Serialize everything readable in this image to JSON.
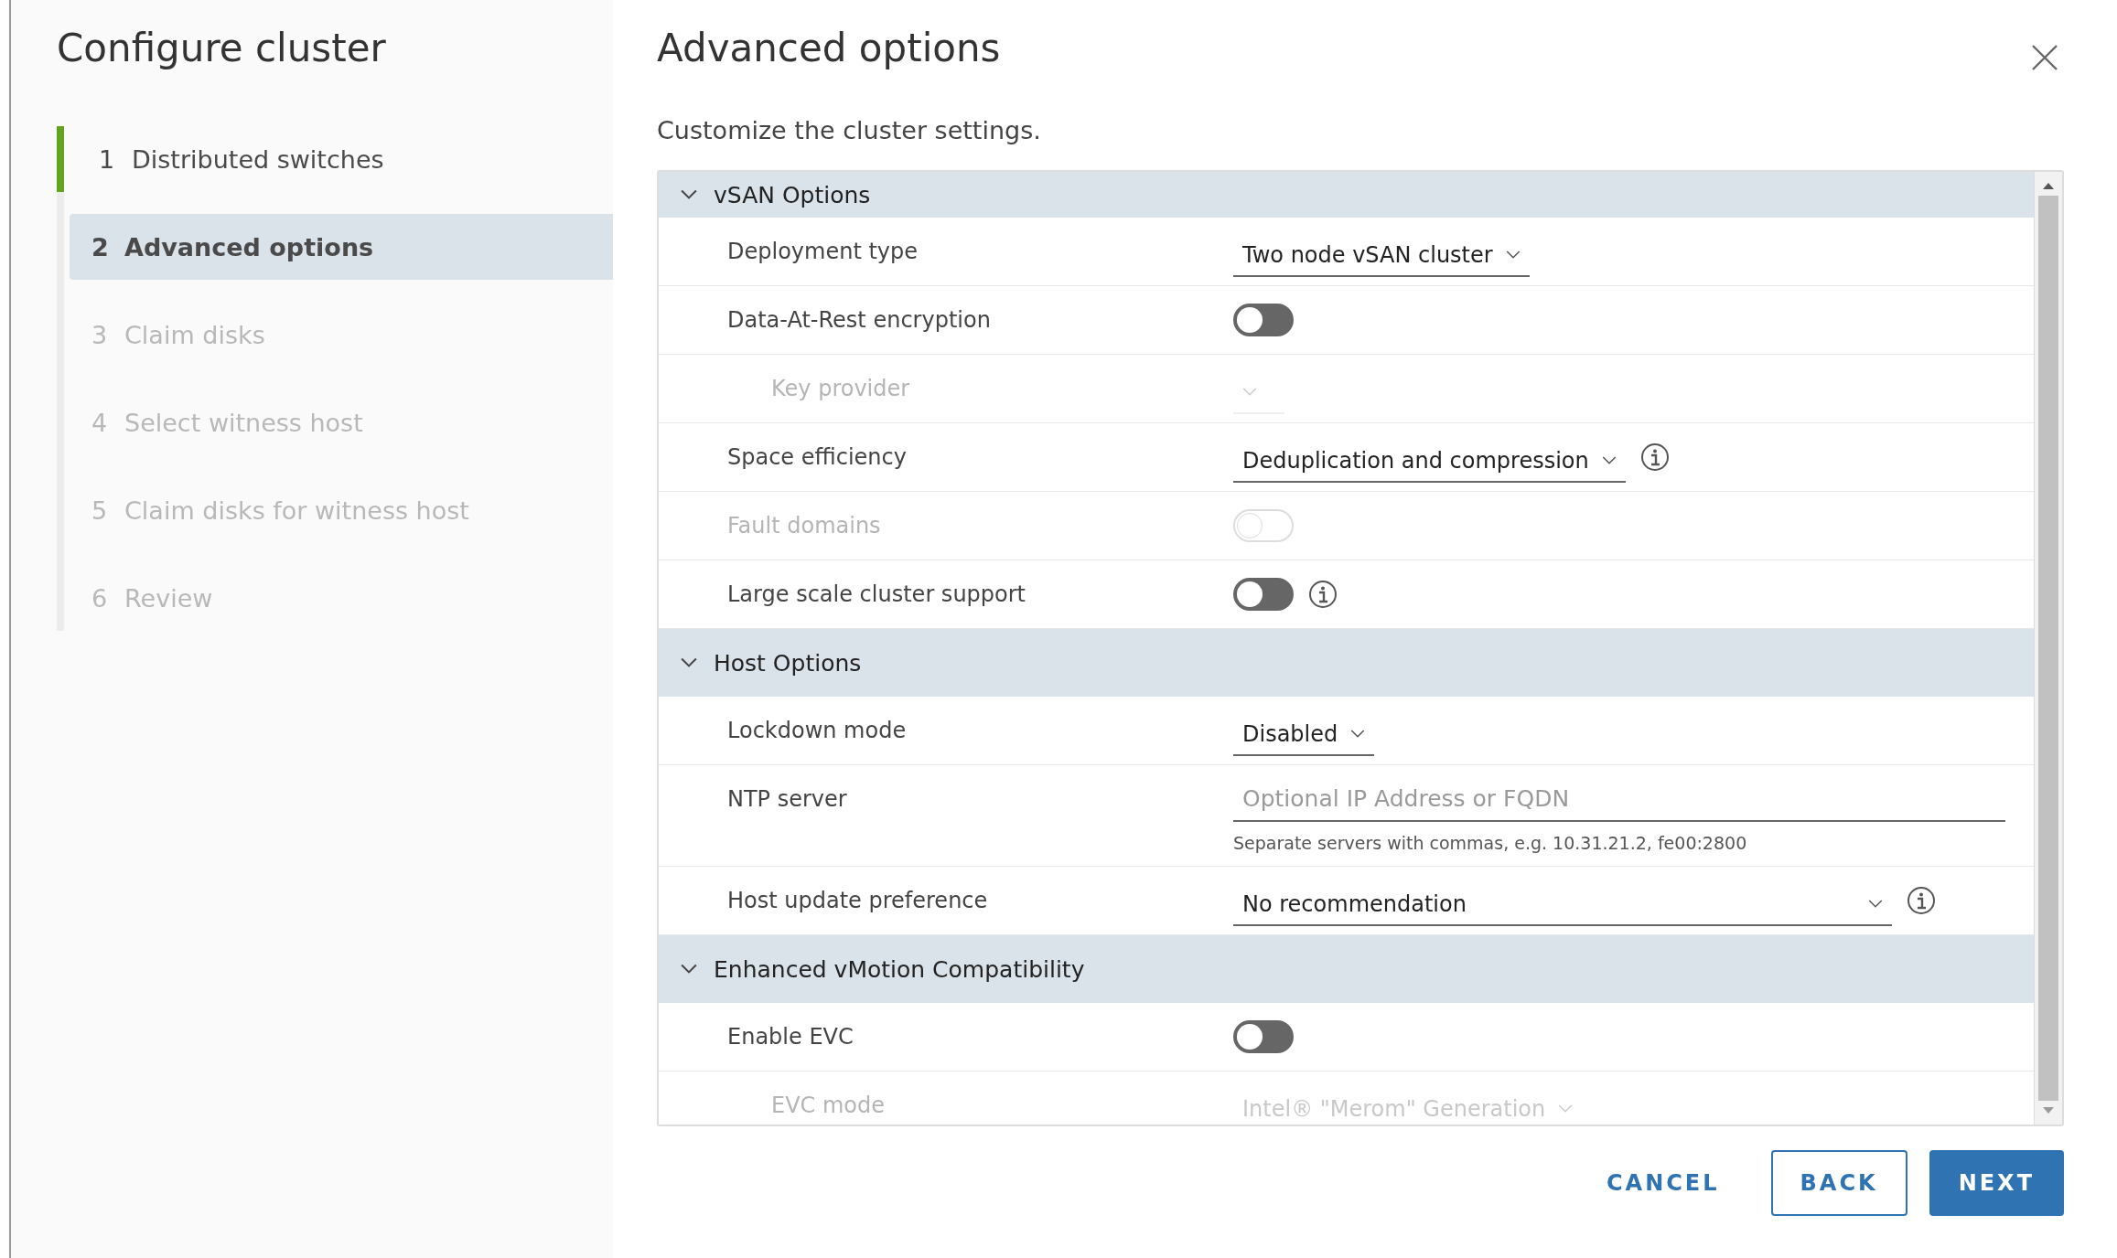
{
  "sidebar": {
    "title": "Configure cluster",
    "steps": [
      {
        "number": "1",
        "label": "Distributed switches",
        "completed": true,
        "selected": false,
        "disabled": false
      },
      {
        "number": "2",
        "label": "Advanced options",
        "completed": false,
        "selected": true,
        "disabled": false
      },
      {
        "number": "3",
        "label": "Claim disks",
        "completed": false,
        "selected": false,
        "disabled": true
      },
      {
        "number": "4",
        "label": "Select witness host",
        "completed": false,
        "selected": false,
        "disabled": true
      },
      {
        "number": "5",
        "label": "Claim disks for witness host",
        "completed": false,
        "selected": false,
        "disabled": true
      },
      {
        "number": "6",
        "label": "Review",
        "completed": false,
        "selected": false,
        "disabled": true
      }
    ]
  },
  "main": {
    "title": "Advanced options",
    "subtitle": "Customize the cluster settings.",
    "sections": [
      {
        "title": "vSAN Options",
        "expanded": true,
        "rows": [
          {
            "kind": "select",
            "label": "Deployment type",
            "value": "Two node vSAN cluster",
            "disabled": false,
            "indented": false
          },
          {
            "kind": "toggle",
            "label": "Data-At-Rest encryption",
            "on": false,
            "disabled": false,
            "indented": false
          },
          {
            "kind": "select",
            "label": "Key provider",
            "disabled": true,
            "indented": true
          },
          {
            "kind": "select",
            "label": "Space efficiency",
            "value": "Deduplication and compression",
            "disabled": false,
            "indented": false,
            "info": true
          },
          {
            "kind": "toggle",
            "label": "Fault domains",
            "on": false,
            "disabled": true,
            "indented": false
          },
          {
            "kind": "toggle",
            "label": "Large scale cluster support",
            "on": false,
            "disabled": false,
            "indented": false,
            "info": true
          }
        ]
      },
      {
        "title": "Host Options",
        "expanded": true,
        "rows": [
          {
            "kind": "select",
            "label": "Lockdown mode",
            "value": "Disabled",
            "disabled": false,
            "indented": false
          },
          {
            "kind": "text",
            "label": "NTP server",
            "placeholder": "Optional IP Address or FQDN",
            "hint": "Separate servers with commas, e.g. 10.31.21.2, fe00:2800",
            "disabled": false,
            "indented": false
          },
          {
            "kind": "wideselect",
            "label": "Host update preference",
            "value": "No recommendation",
            "disabled": false,
            "indented": false,
            "info": true
          }
        ]
      },
      {
        "title": "Enhanced vMotion Compatibility",
        "expanded": true,
        "rows": [
          {
            "kind": "toggle",
            "label": "Enable EVC",
            "on": false,
            "disabled": false,
            "indented": false
          },
          {
            "kind": "select",
            "label": "EVC mode",
            "value": "Intel® \"Merom\" Generation",
            "disabled": true,
            "indented": true
          }
        ]
      }
    ]
  },
  "buttons": [
    {
      "kind": "flat",
      "label": "CANCEL"
    },
    {
      "kind": "outline",
      "label": "BACK"
    },
    {
      "kind": "primary",
      "label": "NEXT"
    }
  ]
}
